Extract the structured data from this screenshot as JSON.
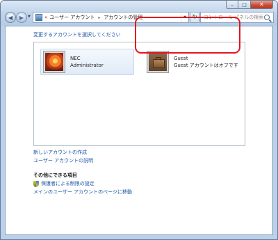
{
  "window": {
    "controls": {
      "minimize": "–",
      "maximize": "□",
      "close": "✕"
    }
  },
  "nav": {
    "back_glyph": "◀",
    "forward_glyph": "▶",
    "address": {
      "overflow": "«",
      "crumbs": [
        "ユーザー アカウント",
        "アカウントの管理"
      ],
      "separator": "▸",
      "dropdown_glyph": "▼"
    },
    "refresh_glyph": "↻",
    "search": {
      "placeholder": "コントロール パネルの検索"
    }
  },
  "main": {
    "heading": "変更するアカウントを選択してください",
    "accounts": [
      {
        "name": "NEC",
        "detail": "Administrator",
        "icon": "flower-avatar-icon",
        "selected": true
      },
      {
        "name": "Guest",
        "detail": "Guest アカウントはオフです",
        "icon": "briefcase-avatar-icon",
        "highlighted": true
      }
    ],
    "links": [
      "新しいアカウントの作成",
      "ユーザー アカウントの説明"
    ],
    "additional_tasks": {
      "title": "その他にできる項目",
      "items": [
        {
          "label": "保護者による制限の設定",
          "icon": "shield-icon"
        },
        {
          "label": "メインのユーザー アカウントのページに移動"
        }
      ]
    }
  },
  "colors": {
    "link": "#1c57a6",
    "highlight_border": "#e4141e",
    "window_frame": "#b9d1ea"
  }
}
